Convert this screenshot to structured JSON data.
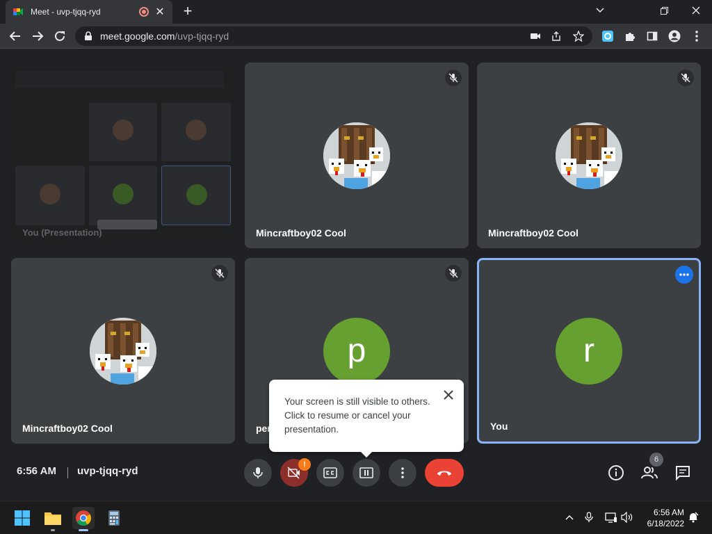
{
  "browser": {
    "tab_title": "Meet - uvp-tjqq-ryd",
    "url_host": "meet.google.com",
    "url_path": "/uvp-tjqq-ryd"
  },
  "presentation": {
    "label": "You (Presentation)"
  },
  "tiles": [
    {
      "name": "Mincraftboy02 Cool"
    },
    {
      "name": "Mincraftboy02 Cool"
    },
    {
      "name": "Mincraftboy02 Cool"
    },
    {
      "name": "per",
      "initial": "p"
    },
    {
      "name": "You",
      "initial": "r"
    }
  ],
  "popup": {
    "text": "Your screen is still visible to others. Click to resume or cancel your presentation."
  },
  "meeting": {
    "time": "6:56 AM",
    "code": "uvp-tjqq-ryd",
    "participant_count": "6",
    "camera_alert": "!"
  },
  "taskbar": {
    "time": "6:56 AM",
    "date": "6/18/2022"
  },
  "colors": {
    "accent": "#8ab4f8",
    "hangup": "#ea4335",
    "avatar_green": "#65a030",
    "tile_bg": "#3c4043"
  }
}
